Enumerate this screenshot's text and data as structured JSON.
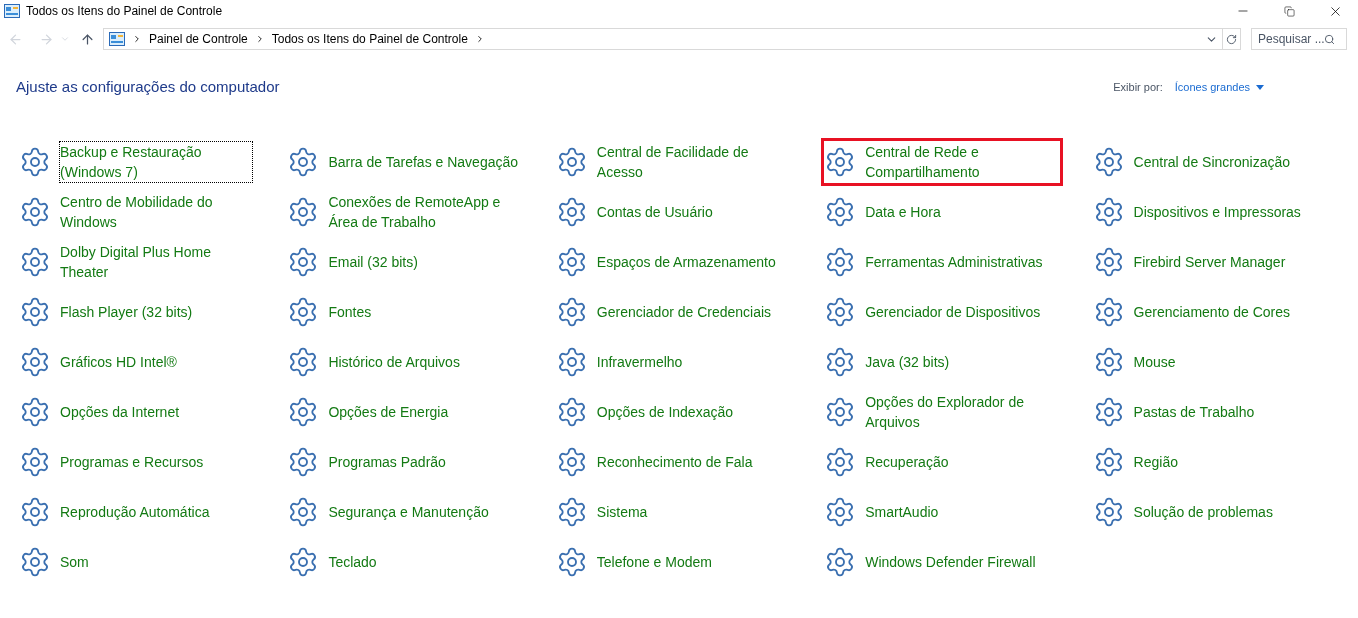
{
  "window": {
    "title": "Todos os Itens do Painel de Controle"
  },
  "address_bar": {
    "breadcrumbs": [
      "Painel de Controle",
      "Todos os Itens do Painel de Controle"
    ]
  },
  "search": {
    "placeholder": "Pesquisar ..."
  },
  "heading": "Ajuste as configurações do computador",
  "view_by": {
    "label": "Exibir por:",
    "value": "Ícones grandes"
  },
  "items": [
    {
      "label": "Backup e Restauração (Windows 7)",
      "focused": true,
      "highlighted": false
    },
    {
      "label": "Barra de Tarefas e Navegação",
      "focused": false,
      "highlighted": false
    },
    {
      "label": "Central de Facilidade de Acesso",
      "focused": false,
      "highlighted": false
    },
    {
      "label": "Central de Rede e Compartilhamento",
      "focused": false,
      "highlighted": true
    },
    {
      "label": "Central de Sincronização",
      "focused": false,
      "highlighted": false
    },
    {
      "label": "Centro de Mobilidade do Windows",
      "focused": false,
      "highlighted": false
    },
    {
      "label": "Conexões de RemoteApp e Área de Trabalho",
      "focused": false,
      "highlighted": false
    },
    {
      "label": "Contas de Usuário",
      "focused": false,
      "highlighted": false
    },
    {
      "label": "Data e Hora",
      "focused": false,
      "highlighted": false
    },
    {
      "label": "Dispositivos e Impressoras",
      "focused": false,
      "highlighted": false
    },
    {
      "label": "Dolby Digital Plus Home Theater",
      "focused": false,
      "highlighted": false
    },
    {
      "label": "Email (32 bits)",
      "focused": false,
      "highlighted": false
    },
    {
      "label": "Espaços de Armazenamento",
      "focused": false,
      "highlighted": false
    },
    {
      "label": "Ferramentas Administrativas",
      "focused": false,
      "highlighted": false
    },
    {
      "label": "Firebird Server Manager",
      "focused": false,
      "highlighted": false
    },
    {
      "label": "Flash Player (32 bits)",
      "focused": false,
      "highlighted": false
    },
    {
      "label": "Fontes",
      "focused": false,
      "highlighted": false
    },
    {
      "label": "Gerenciador de Credenciais",
      "focused": false,
      "highlighted": false
    },
    {
      "label": "Gerenciador de Dispositivos",
      "focused": false,
      "highlighted": false
    },
    {
      "label": "Gerenciamento de Cores",
      "focused": false,
      "highlighted": false
    },
    {
      "label": "Gráficos HD Intel®",
      "focused": false,
      "highlighted": false
    },
    {
      "label": "Histórico de Arquivos",
      "focused": false,
      "highlighted": false
    },
    {
      "label": "Infravermelho",
      "focused": false,
      "highlighted": false
    },
    {
      "label": "Java (32 bits)",
      "focused": false,
      "highlighted": false
    },
    {
      "label": "Mouse",
      "focused": false,
      "highlighted": false
    },
    {
      "label": "Opções da Internet",
      "focused": false,
      "highlighted": false
    },
    {
      "label": "Opções de Energia",
      "focused": false,
      "highlighted": false
    },
    {
      "label": "Opções de Indexação",
      "focused": false,
      "highlighted": false
    },
    {
      "label": "Opções do Explorador de Arquivos",
      "focused": false,
      "highlighted": false
    },
    {
      "label": "Pastas de Trabalho",
      "focused": false,
      "highlighted": false
    },
    {
      "label": "Programas e Recursos",
      "focused": false,
      "highlighted": false
    },
    {
      "label": "Programas Padrão",
      "focused": false,
      "highlighted": false
    },
    {
      "label": "Reconhecimento de Fala",
      "focused": false,
      "highlighted": false
    },
    {
      "label": "Recuperação",
      "focused": false,
      "highlighted": false
    },
    {
      "label": "Região",
      "focused": false,
      "highlighted": false
    },
    {
      "label": "Reprodução Automática",
      "focused": false,
      "highlighted": false
    },
    {
      "label": "Segurança e Manutenção",
      "focused": false,
      "highlighted": false
    },
    {
      "label": "Sistema",
      "focused": false,
      "highlighted": false
    },
    {
      "label": "SmartAudio",
      "focused": false,
      "highlighted": false
    },
    {
      "label": "Solução de problemas",
      "focused": false,
      "highlighted": false
    },
    {
      "label": "Som",
      "focused": false,
      "highlighted": false
    },
    {
      "label": "Teclado",
      "focused": false,
      "highlighted": false
    },
    {
      "label": "Telefone e Modem",
      "focused": false,
      "highlighted": false
    },
    {
      "label": "Windows Defender Firewall",
      "focused": false,
      "highlighted": false
    }
  ]
}
